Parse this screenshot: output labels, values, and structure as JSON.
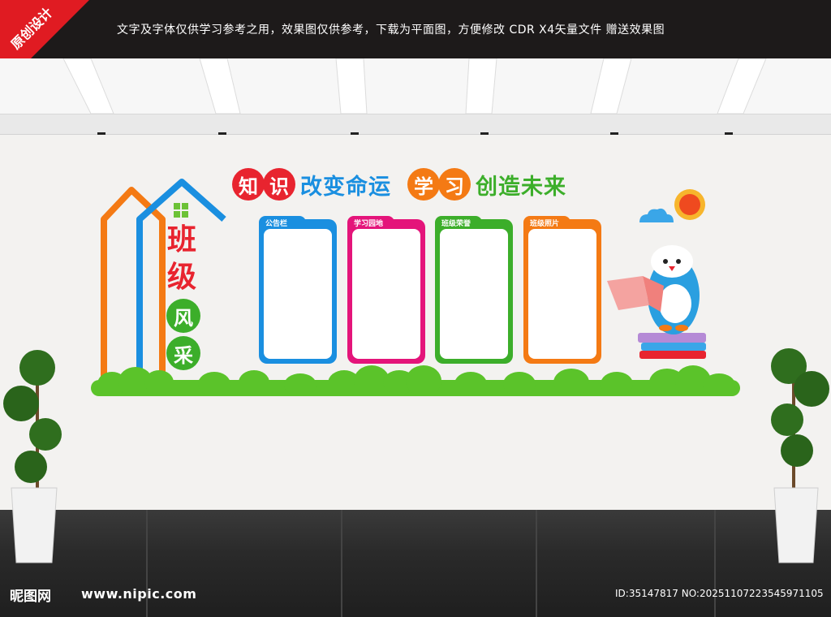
{
  "banner": {
    "text": "文字及字体仅供学习参考之用，效果图仅供参考，下载为平面图，方便修改    CDR X4矢量文件  赠送效果图",
    "ribbon": "原创设计"
  },
  "slogan": {
    "part1": [
      "知",
      "识"
    ],
    "part1_rest": "改变命运",
    "part2": [
      "学",
      "习"
    ],
    "part2_rest": "创造未来"
  },
  "house_title": [
    "班",
    "级",
    "风",
    "采"
  ],
  "panels": [
    {
      "label": "公告栏",
      "color": "#1a8fe0"
    },
    {
      "label": "学习园地",
      "color": "#e4147a"
    },
    {
      "label": "班级荣誉",
      "color": "#3cae2a"
    },
    {
      "label": "班级照片",
      "color": "#f47a14"
    }
  ],
  "footer": {
    "logo": "昵图网",
    "url": "www.nipic.com",
    "id": "ID:35147817 NO:20251107223545971105"
  },
  "colors": {
    "red": "#e8242f",
    "orange": "#f47a14",
    "blue": "#1a8fe0",
    "green": "#3cae2a",
    "bush": "#5bc32a"
  }
}
